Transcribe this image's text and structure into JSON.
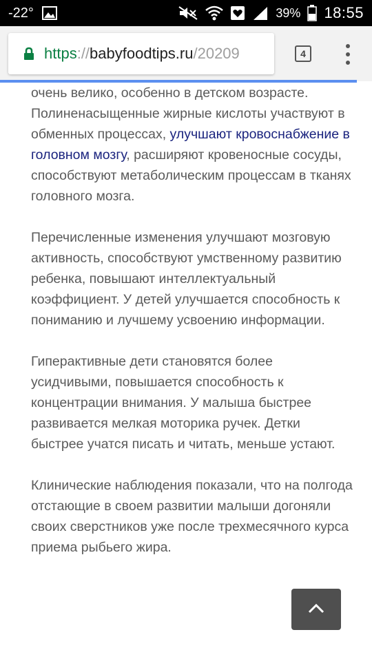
{
  "status_bar": {
    "temperature": "-22°",
    "battery_percent": "39%",
    "time": "18:55",
    "icons": [
      "gallery-icon",
      "mute-icon",
      "wifi-icon",
      "heart-icon",
      "signal-icon",
      "battery-icon"
    ]
  },
  "browser": {
    "url_scheme": "https",
    "url_separator": "://",
    "url_host": "babyfoodtips.ru",
    "url_path": "/20209",
    "tab_count": "4",
    "page_load_progress": 0.96,
    "colors": {
      "secure": "#0b8043",
      "progress": "#5b8ff0"
    }
  },
  "article": {
    "p1_text1": "очень велико, особенно в детском возрасте. Полиненасыщенные жирные кислоты участвуют в обменных процессах, ",
    "p1_link": "улучшают кровоснабжение в головном мозгу",
    "p1_text2": ", расширяют кровеносные сосуды, способствуют метаболическим процессам в тканях головного мозга.",
    "p2": "Перечисленные изменения улучшают мозговую активность, способствуют умственному развитию ребенка, повышают интеллектуальный коэффициент. У детей улучшается способность к пониманию и лучшему усвоению информации.",
    "p3": "Гиперактивные дети становятся более усидчивыми, повышается способность к концентрации внимания. У малыша быстрее развивается мелкая моторика ручек. Детки быстрее учатся писать и читать, меньше устают.",
    "p4": "Клинические наблюдения показали, что на полгода отстающие в своем развитии малыши догоняли своих сверстников уже после трехмесячного курса приема рыбьего жира.",
    "link_color": "#1a237e"
  },
  "scroll_top_icon": "chevron-up-icon"
}
